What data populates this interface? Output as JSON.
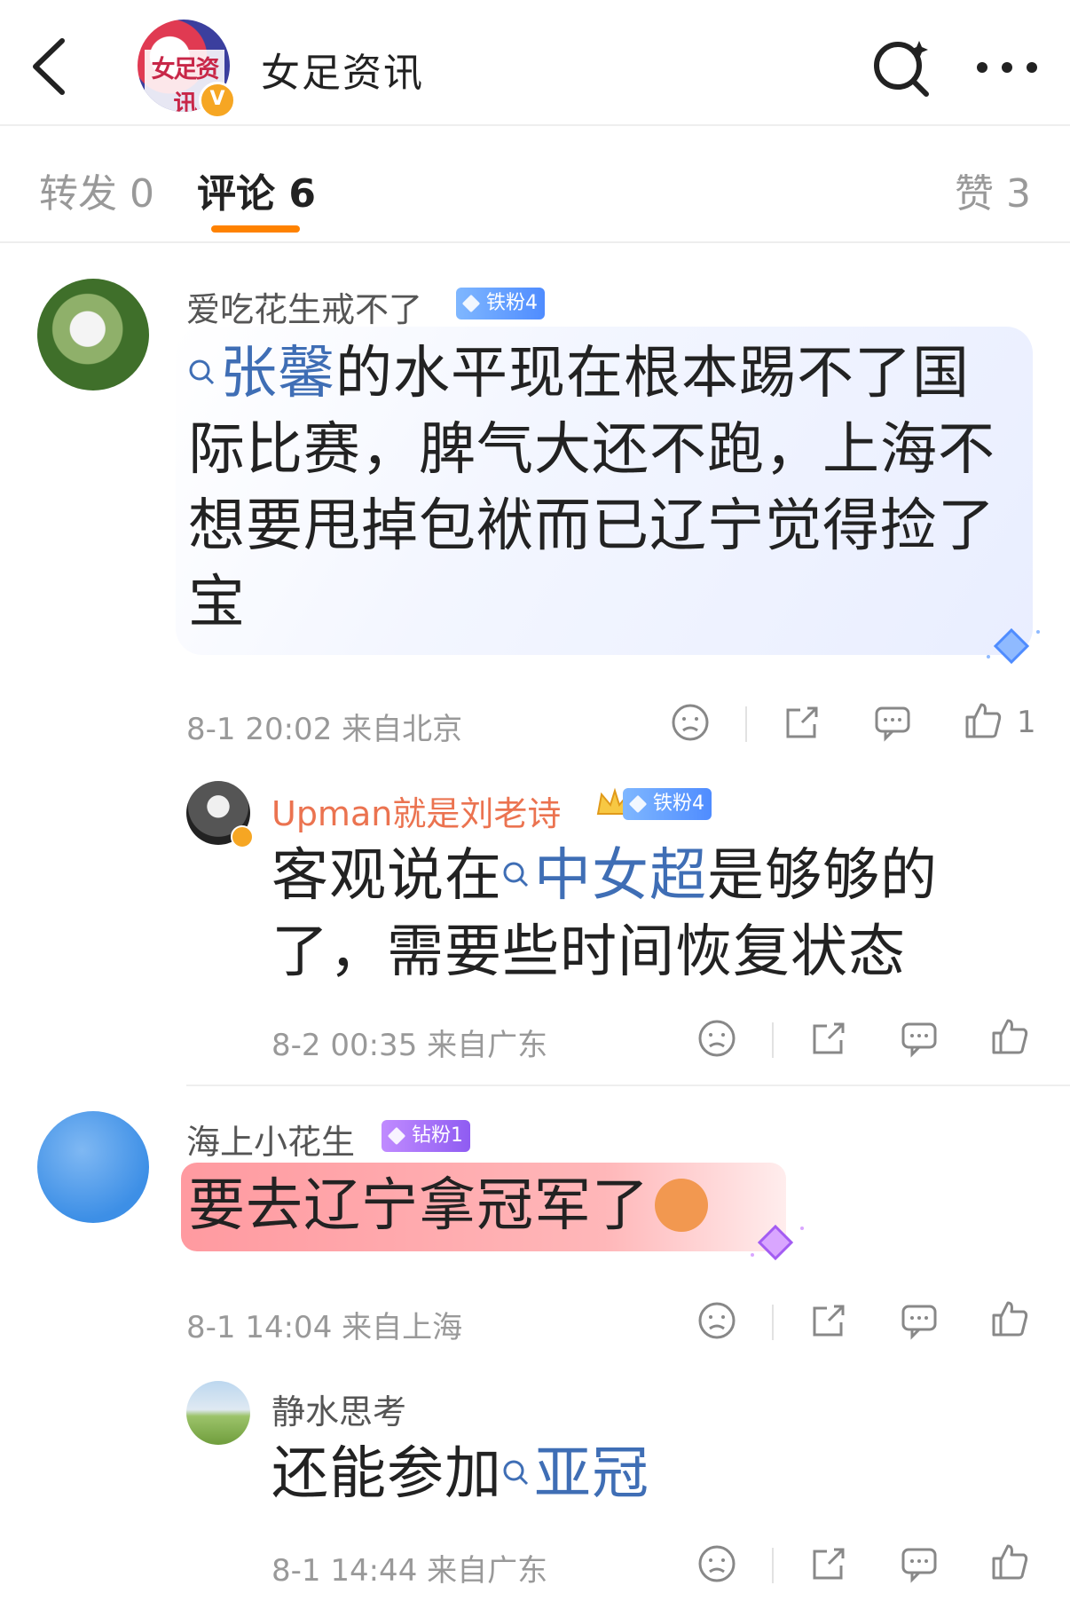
{
  "header": {
    "account_name": "女足资讯",
    "logo_text": "女足资讯",
    "verify_mark": "V"
  },
  "tabs": {
    "repost": "转发 0",
    "comment": "评论 6",
    "like": "赞 3"
  },
  "comments": [
    {
      "username": "爱吃花生戒不了",
      "badge": "铁粉4",
      "text_topic": "张馨",
      "text_rest_1": "的水平现在根本踢不了国",
      "text_line2": "际比赛，脾气大还不跑，上海不",
      "text_line3": "想要甩掉包袱而已辽宁觉得捡了",
      "text_line4": "宝",
      "meta": "8-1 20:02  来自北京",
      "like_count": "1",
      "replies": [
        {
          "username": "Upman就是刘老诗",
          "badge": "铁粉4",
          "text_pre": "客观说在",
          "text_topic": "中女超",
          "text_post": "是够够的",
          "text_line2": "了，需要些时间恢复状态",
          "meta": "8-2 00:35  来自广东"
        }
      ]
    },
    {
      "username": "海上小花生",
      "badge": "钻粉1",
      "text": "要去辽宁拿冠军了",
      "meta": "8-1 14:04  来自上海",
      "replies": [
        {
          "username": "静水思考",
          "text_pre": "还能参加",
          "text_topic": "亚冠",
          "meta": "8-1 14:44  来自广东"
        }
      ]
    }
  ],
  "colors": {
    "accent": "#ff8200",
    "topic": "#3f6eb5",
    "username_vip": "#eb7350"
  }
}
